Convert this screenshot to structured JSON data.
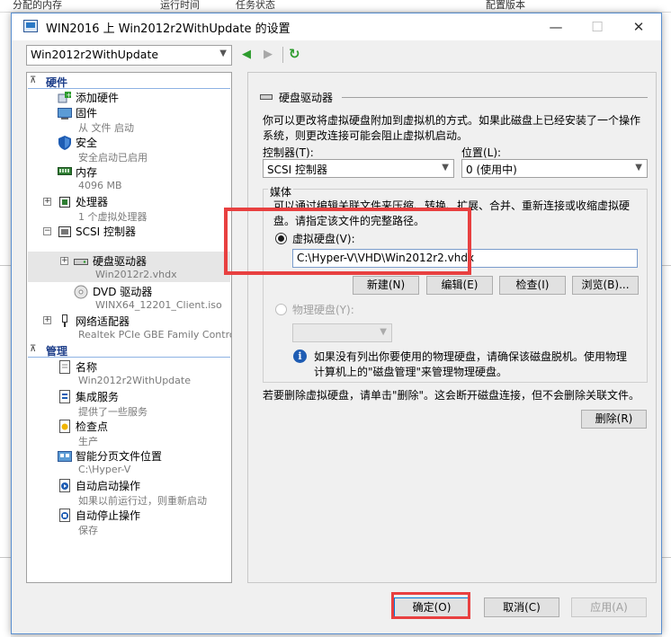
{
  "background": {
    "columns": [
      "分配的内存",
      "运行时间",
      "任务状态",
      "配置版本"
    ]
  },
  "window": {
    "title": "WIN2016 上 Win2012r2WithUpdate 的设置",
    "minimize": "—",
    "maximize": "☐",
    "close": "✕"
  },
  "vm_selector": {
    "value": "Win2012r2WithUpdate"
  },
  "nav": {
    "back": "◀",
    "forward": "▶",
    "refresh": "↻"
  },
  "tree": {
    "hardware_header": "硬件",
    "management_header": "管理",
    "items": {
      "add_hardware": "添加硬件",
      "firmware": "固件",
      "firmware_sub": "从 文件 启动",
      "security": "安全",
      "security_sub": "安全启动已启用",
      "memory": "内存",
      "memory_sub": "4096 MB",
      "processor": "处理器",
      "processor_sub": "1 个虚拟处理器",
      "scsi": "SCSI 控制器",
      "hard_drive": "硬盘驱动器",
      "hard_drive_sub": "Win2012r2.vhdx",
      "dvd": "DVD 驱动器",
      "dvd_sub": "WINX64_12201_Client.iso",
      "network": "网络适配器",
      "network_sub": "Realtek PCIe GBE Family Controller ...",
      "name": "名称",
      "name_sub": "Win2012r2WithUpdate",
      "integration": "集成服务",
      "integration_sub": "提供了一些服务",
      "checkpoint": "检查点",
      "checkpoint_sub": "生产",
      "smart_paging": "智能分页文件位置",
      "smart_paging_sub": "C:\\Hyper-V",
      "auto_start": "自动启动操作",
      "auto_start_sub": "如果以前运行过，则重新启动",
      "auto_stop": "自动停止操作",
      "auto_stop_sub": "保存"
    }
  },
  "panel": {
    "title": "硬盘驱动器",
    "description_line1": "你可以更改将虚拟硬盘附加到虚拟机的方式。如果此磁盘上已经安装了一个操作",
    "description_line2": "系统，则更改连接可能会阻止虚拟机启动。",
    "controller_label": "控制器(T):",
    "controller_value": "SCSI 控制器",
    "location_label": "位置(L):",
    "location_value": "0 (使用中)",
    "media_label": "媒体",
    "media_desc_line1": "可以通过编辑关联文件来压缩、转换、扩展、合并、重新连接或收缩虚拟硬",
    "media_desc_line2": "盘。请指定该文件的完整路径。",
    "virtual_disk_label": "虚拟硬盘(V):",
    "virtual_disk_path": "C:\\Hyper-V\\VHD\\Win2012r2.vhdx",
    "btn_new": "新建(N)",
    "btn_edit": "编辑(E)",
    "btn_inspect": "检查(I)",
    "btn_browse": "浏览(B)...",
    "physical_disk_label": "物理硬盘(Y):",
    "physical_info_line1": "如果没有列出你要使用的物理硬盘，请确保该磁盘脱机。使用物理",
    "physical_info_line2": "计算机上的\"磁盘管理\"来管理物理硬盘。",
    "remove_desc": "若要删除虚拟硬盘，请单击\"删除\"。这会断开磁盘连接，但不会删除关联文件。",
    "btn_remove": "删除(R)"
  },
  "footer": {
    "ok": "确定(O)",
    "cancel": "取消(C)",
    "apply": "应用(A)"
  },
  "colors": {
    "highlight": "#e84040",
    "section_header": "#1e3f8a",
    "accent": "#0078d7"
  }
}
